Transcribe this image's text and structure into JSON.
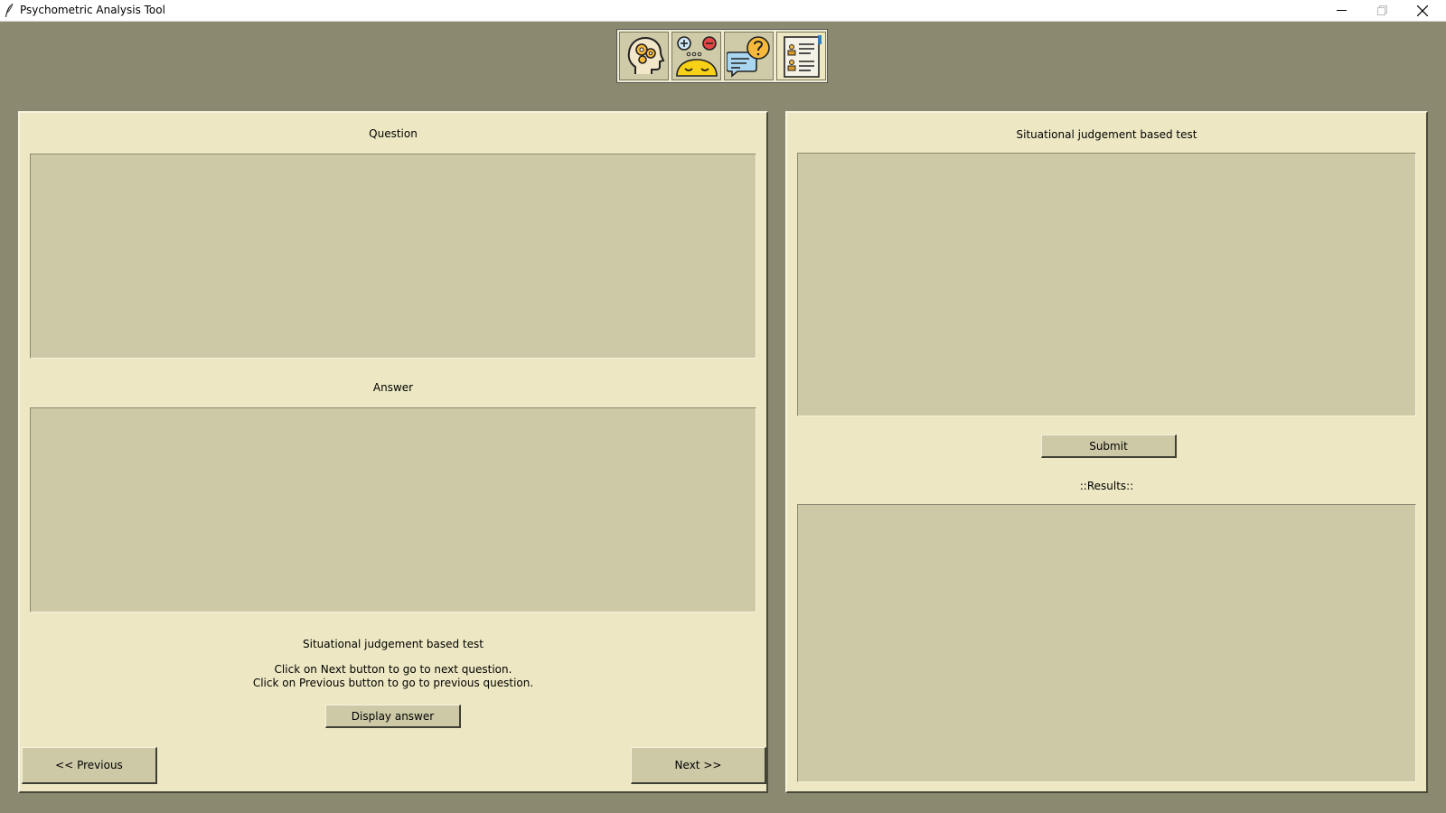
{
  "window": {
    "title": "Psychometric Analysis Tool"
  },
  "toolbar": {
    "icons": [
      "brain-gears-icon",
      "emotion-faces-icon",
      "chat-question-icon",
      "profile-document-icon"
    ]
  },
  "left": {
    "question_label": "Question",
    "answer_label": "Answer",
    "test_title": "Situational judgement based test",
    "hint_line1": "Click on Next button to go to next question.",
    "hint_line2": "Click on Previous button to go to previous question.",
    "display_answer_label": "Display answer",
    "previous_label": "<< Previous",
    "next_label": "Next >>"
  },
  "right": {
    "test_title": "Situational judgement based test",
    "submit_label": "Submit",
    "results_label": "::Results::"
  },
  "colors": {
    "background": "#8b8a70",
    "panel": "#ede8c3",
    "textbox": "#cdc9a7"
  }
}
